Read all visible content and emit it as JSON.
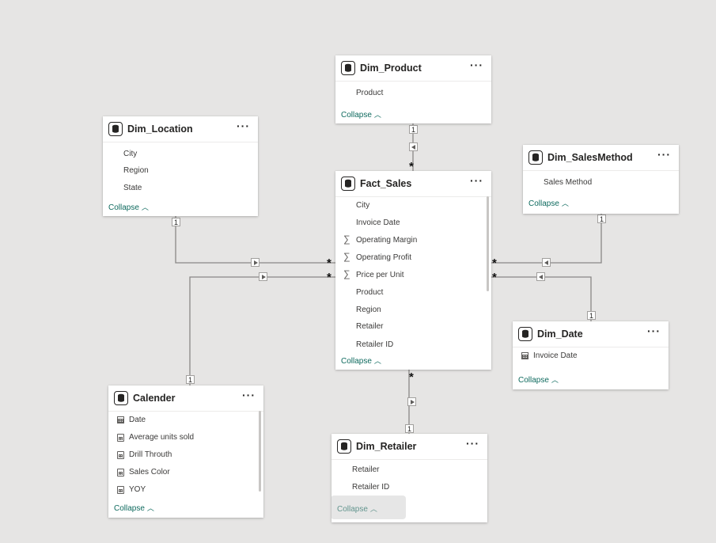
{
  "tables": {
    "dim_product": {
      "title": "Dim_Product",
      "fields": [
        {
          "name": "Product",
          "kind": "plain"
        }
      ],
      "collapse": "Collapse"
    },
    "dim_location": {
      "title": "Dim_Location",
      "fields": [
        {
          "name": "City",
          "kind": "plain"
        },
        {
          "name": "Region",
          "kind": "plain"
        },
        {
          "name": "State",
          "kind": "plain"
        }
      ],
      "collapse": "Collapse"
    },
    "dim_salesmethod": {
      "title": "Dim_SalesMethod",
      "fields": [
        {
          "name": "Sales Method",
          "kind": "plain"
        }
      ],
      "collapse": "Collapse"
    },
    "fact_sales": {
      "title": "Fact_Sales",
      "fields": [
        {
          "name": "City",
          "kind": "plain"
        },
        {
          "name": "Invoice Date",
          "kind": "plain"
        },
        {
          "name": "Operating Margin",
          "kind": "sum"
        },
        {
          "name": "Operating Profit",
          "kind": "sum"
        },
        {
          "name": "Price per Unit",
          "kind": "sum"
        },
        {
          "name": "Product",
          "kind": "plain"
        },
        {
          "name": "Region",
          "kind": "plain"
        },
        {
          "name": "Retailer",
          "kind": "plain"
        },
        {
          "name": "Retailer ID",
          "kind": "plain"
        }
      ],
      "collapse": "Collapse"
    },
    "dim_date": {
      "title": "Dim_Date",
      "fields": [
        {
          "name": "Invoice Date",
          "kind": "calendar"
        }
      ],
      "collapse": "Collapse"
    },
    "calender": {
      "title": "Calender",
      "fields": [
        {
          "name": "Date",
          "kind": "calendar"
        },
        {
          "name": "Average units sold",
          "kind": "calc"
        },
        {
          "name": "Drill Throuth",
          "kind": "calc"
        },
        {
          "name": "Sales Color",
          "kind": "calc"
        },
        {
          "name": "YOY",
          "kind": "calc"
        }
      ],
      "collapse": "Collapse"
    },
    "dim_retailer": {
      "title": "Dim_Retailer",
      "fields": [
        {
          "name": "Retailer",
          "kind": "plain"
        },
        {
          "name": "Retailer ID",
          "kind": "plain"
        }
      ],
      "collapse": "Collapse"
    }
  },
  "relationships": [
    {
      "from": "Dim_Product",
      "to": "Fact_Sales",
      "one": "1",
      "many": "*"
    },
    {
      "from": "Dim_Location",
      "to": "Fact_Sales",
      "one": "1",
      "many": "*"
    },
    {
      "from": "Calender",
      "to": "Fact_Sales",
      "one": "1",
      "many": "*"
    },
    {
      "from": "Dim_SalesMethod",
      "to": "Fact_Sales",
      "one": "1",
      "many": "*"
    },
    {
      "from": "Dim_Date",
      "to": "Fact_Sales",
      "one": "1",
      "many": "*"
    },
    {
      "from": "Dim_Retailer",
      "to": "Fact_Sales",
      "one": "1",
      "many": "*"
    }
  ],
  "icons": {
    "table": "database-icon",
    "more": "more-options-icon",
    "collapse": "chevron-up-icon",
    "measure": "sigma-icon"
  },
  "colors": {
    "canvas": "#e6e5e4",
    "card": "#ffffff",
    "collapse_link": "#0e6a5e",
    "line": "#8a8886"
  }
}
